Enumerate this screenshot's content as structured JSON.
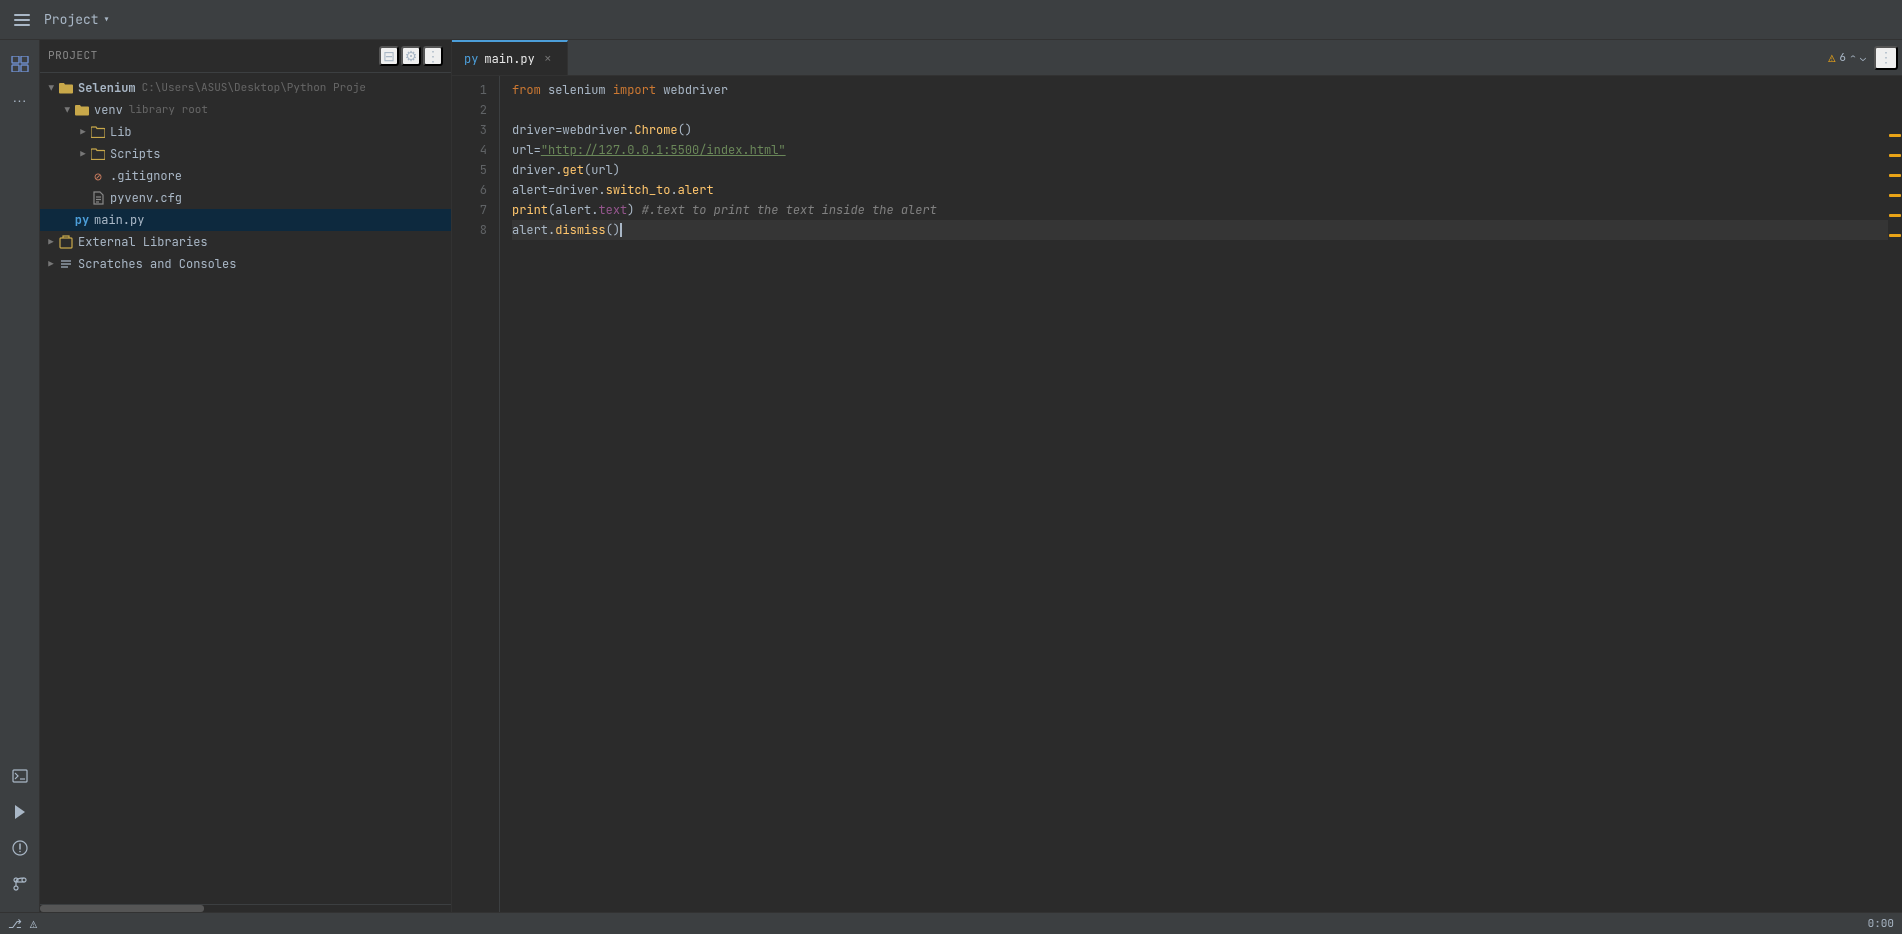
{
  "topbar": {
    "project_label": "Project",
    "chevron": "▾"
  },
  "sidebar": {
    "project_root": "Selenium",
    "project_path": "C:\\Users\\ASUS\\Desktop\\Python Proje",
    "venv_label": "venv",
    "venv_note": "library root",
    "lib_label": "Lib",
    "scripts_label": "Scripts",
    "gitignore_label": ".gitignore",
    "pyvenv_label": "pyvenv.cfg",
    "main_label": "main.py",
    "extlib_label": "External Libraries",
    "scratches_label": "Scratches and Consoles"
  },
  "editor": {
    "tab_label": "main.py",
    "warning_count": "6",
    "lines": [
      {
        "num": 1,
        "tokens": [
          {
            "t": "from",
            "c": "kw-from"
          },
          {
            "t": " ",
            "c": ""
          },
          {
            "t": "selenium",
            "c": "mod-selenium"
          },
          {
            "t": " ",
            "c": ""
          },
          {
            "t": "import",
            "c": "kw-import"
          },
          {
            "t": " ",
            "c": ""
          },
          {
            "t": "webdriver",
            "c": "mod-webdriver"
          }
        ]
      },
      {
        "num": 2,
        "tokens": []
      },
      {
        "num": 3,
        "tokens": [
          {
            "t": "driver",
            "c": "var-name"
          },
          {
            "t": "=",
            "c": ""
          },
          {
            "t": "webdriver",
            "c": "var-name"
          },
          {
            "t": ".",
            "c": ""
          },
          {
            "t": "Chrome",
            "c": "method-name"
          },
          {
            "t": "()",
            "c": "paren"
          }
        ]
      },
      {
        "num": 4,
        "tokens": [
          {
            "t": "url",
            "c": "var-name"
          },
          {
            "t": "=",
            "c": ""
          },
          {
            "t": "\"http://127.0.0.1:5500/index.html\"",
            "c": "string-val"
          }
        ]
      },
      {
        "num": 5,
        "tokens": [
          {
            "t": "driver",
            "c": "var-name"
          },
          {
            "t": ".",
            "c": ""
          },
          {
            "t": "get",
            "c": "method-name"
          },
          {
            "t": "(",
            "c": "paren"
          },
          {
            "t": "url",
            "c": "var-name"
          },
          {
            "t": ")",
            "c": "paren"
          }
        ]
      },
      {
        "num": 6,
        "tokens": [
          {
            "t": "alert",
            "c": "var-name"
          },
          {
            "t": "=",
            "c": ""
          },
          {
            "t": "driver",
            "c": "var-name"
          },
          {
            "t": ".",
            "c": ""
          },
          {
            "t": "switch_to",
            "c": "method-name"
          },
          {
            "t": ".",
            "c": ""
          },
          {
            "t": "alert",
            "c": "method-name"
          }
        ]
      },
      {
        "num": 7,
        "tokens": [
          {
            "t": "print",
            "c": "func-call"
          },
          {
            "t": "(",
            "c": "paren"
          },
          {
            "t": "alert",
            "c": "var-name"
          },
          {
            "t": ".",
            "c": ""
          },
          {
            "t": "text",
            "c": "param-name"
          },
          {
            "t": ")",
            "c": "paren"
          },
          {
            "t": " #.text to print the text inside the alert",
            "c": "comment"
          }
        ]
      },
      {
        "num": 8,
        "tokens": [
          {
            "t": "alert",
            "c": "var-name"
          },
          {
            "t": ".",
            "c": ""
          },
          {
            "t": "dismiss",
            "c": "method-name"
          },
          {
            "t": "()",
            "c": "paren"
          }
        ]
      }
    ]
  },
  "bottombar": {
    "time": "0:00"
  },
  "icons": {
    "menu": "☰",
    "structure": "⊞",
    "dots": "···",
    "folder_open": "📁",
    "folder_closed": "📁",
    "arrow_right": "▶",
    "arrow_down": "▼",
    "lib_box": "⊡",
    "scratch": "≡",
    "terminal": "⌨",
    "run": "▶",
    "debug": "⚠",
    "git": "⎇",
    "warning_tri": "⚠",
    "close_x": "✕",
    "chevron_up": "⌃",
    "chevron_down": "⌄",
    "more_vert": "⋮"
  }
}
